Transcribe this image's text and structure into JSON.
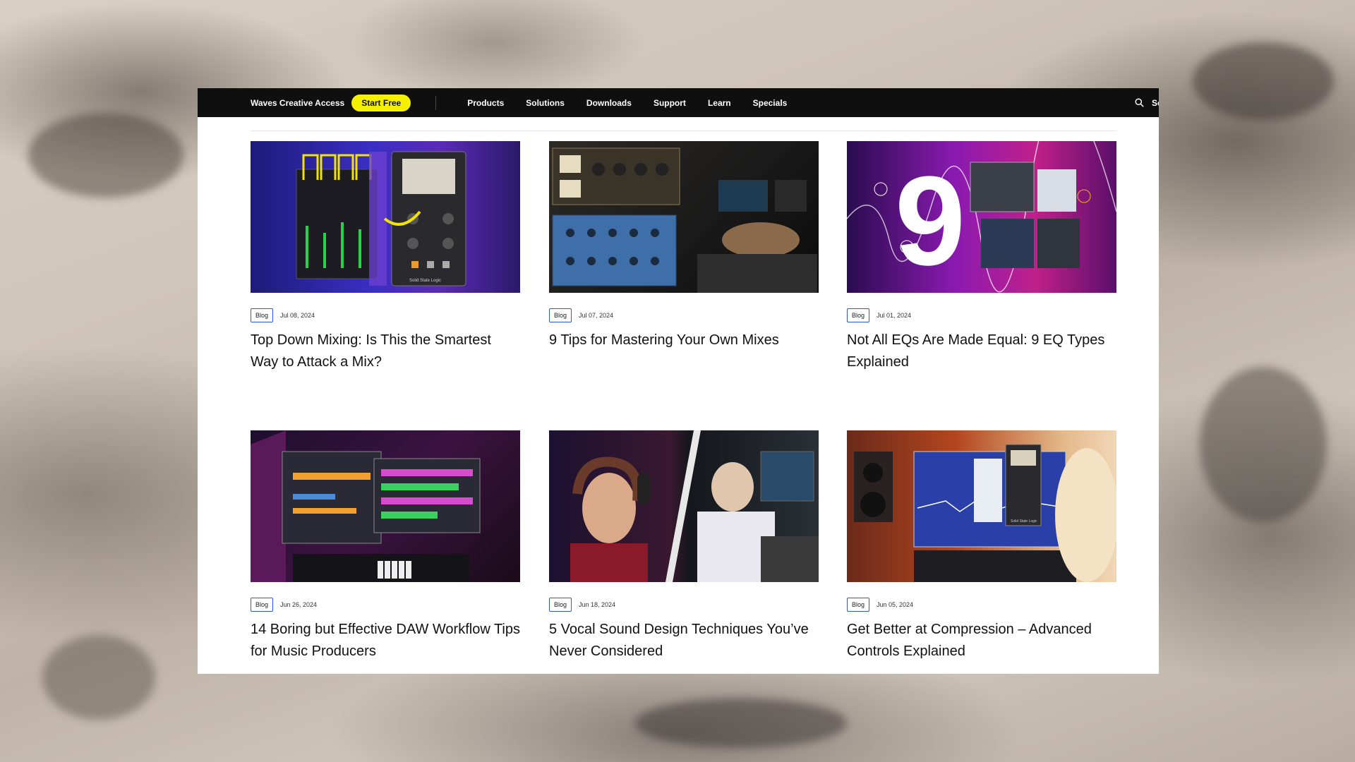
{
  "navbar": {
    "brand": "Waves Creative Access",
    "cta_label": "Start Free",
    "links": [
      "Products",
      "Solutions",
      "Downloads",
      "Support",
      "Learn",
      "Specials"
    ],
    "search_label": "Se"
  },
  "posts": [
    {
      "tag": "Blog",
      "date": "Jul 08, 2024",
      "title": "Top Down Mixing: Is This the Smartest Way to Attack a Mix?"
    },
    {
      "tag": "Blog",
      "date": "Jul 07, 2024",
      "title": "9 Tips for Mastering Your Own Mixes"
    },
    {
      "tag": "Blog",
      "date": "Jul 01, 2024",
      "title": "Not All EQs Are Made Equal: 9 EQ Types Explained"
    },
    {
      "tag": "Blog",
      "date": "Jun 26, 2024",
      "title": "14 Boring but Effective DAW Workflow Tips for Music Producers"
    },
    {
      "tag": "Blog",
      "date": "Jun 18, 2024",
      "title": "5 Vocal Sound Design Techniques You’ve Never Considered"
    },
    {
      "tag": "Blog",
      "date": "Jun 05, 2024",
      "title": "Get Better at Compression – Advanced Controls Explained"
    }
  ],
  "thumb_labels": {
    "post_0": "Solid State Logic",
    "post_2": "9",
    "post_5": "Solid State Logic"
  }
}
